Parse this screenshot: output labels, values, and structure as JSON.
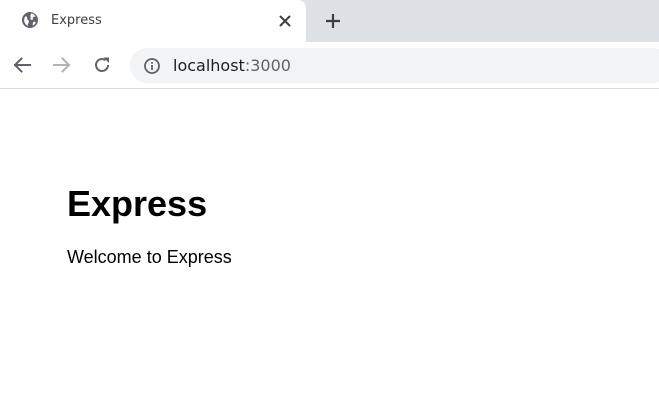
{
  "browser": {
    "tab": {
      "title": "Express",
      "favicon": "globe-icon",
      "close_icon": "close-icon"
    },
    "new_tab_icon": "plus-icon",
    "toolbar": {
      "back_icon": "back-arrow-icon",
      "forward_icon": "forward-arrow-icon",
      "reload_icon": "reload-icon",
      "omnibox": {
        "info_icon": "info-icon",
        "host": "localhost",
        "port": ":3000"
      }
    },
    "colors": {
      "tabstrip_bg": "#dee1e6",
      "omnibox_bg": "#f1f3f4",
      "icon_color": "#5f6368"
    }
  },
  "page": {
    "heading": "Express",
    "text": "Welcome to Express"
  }
}
